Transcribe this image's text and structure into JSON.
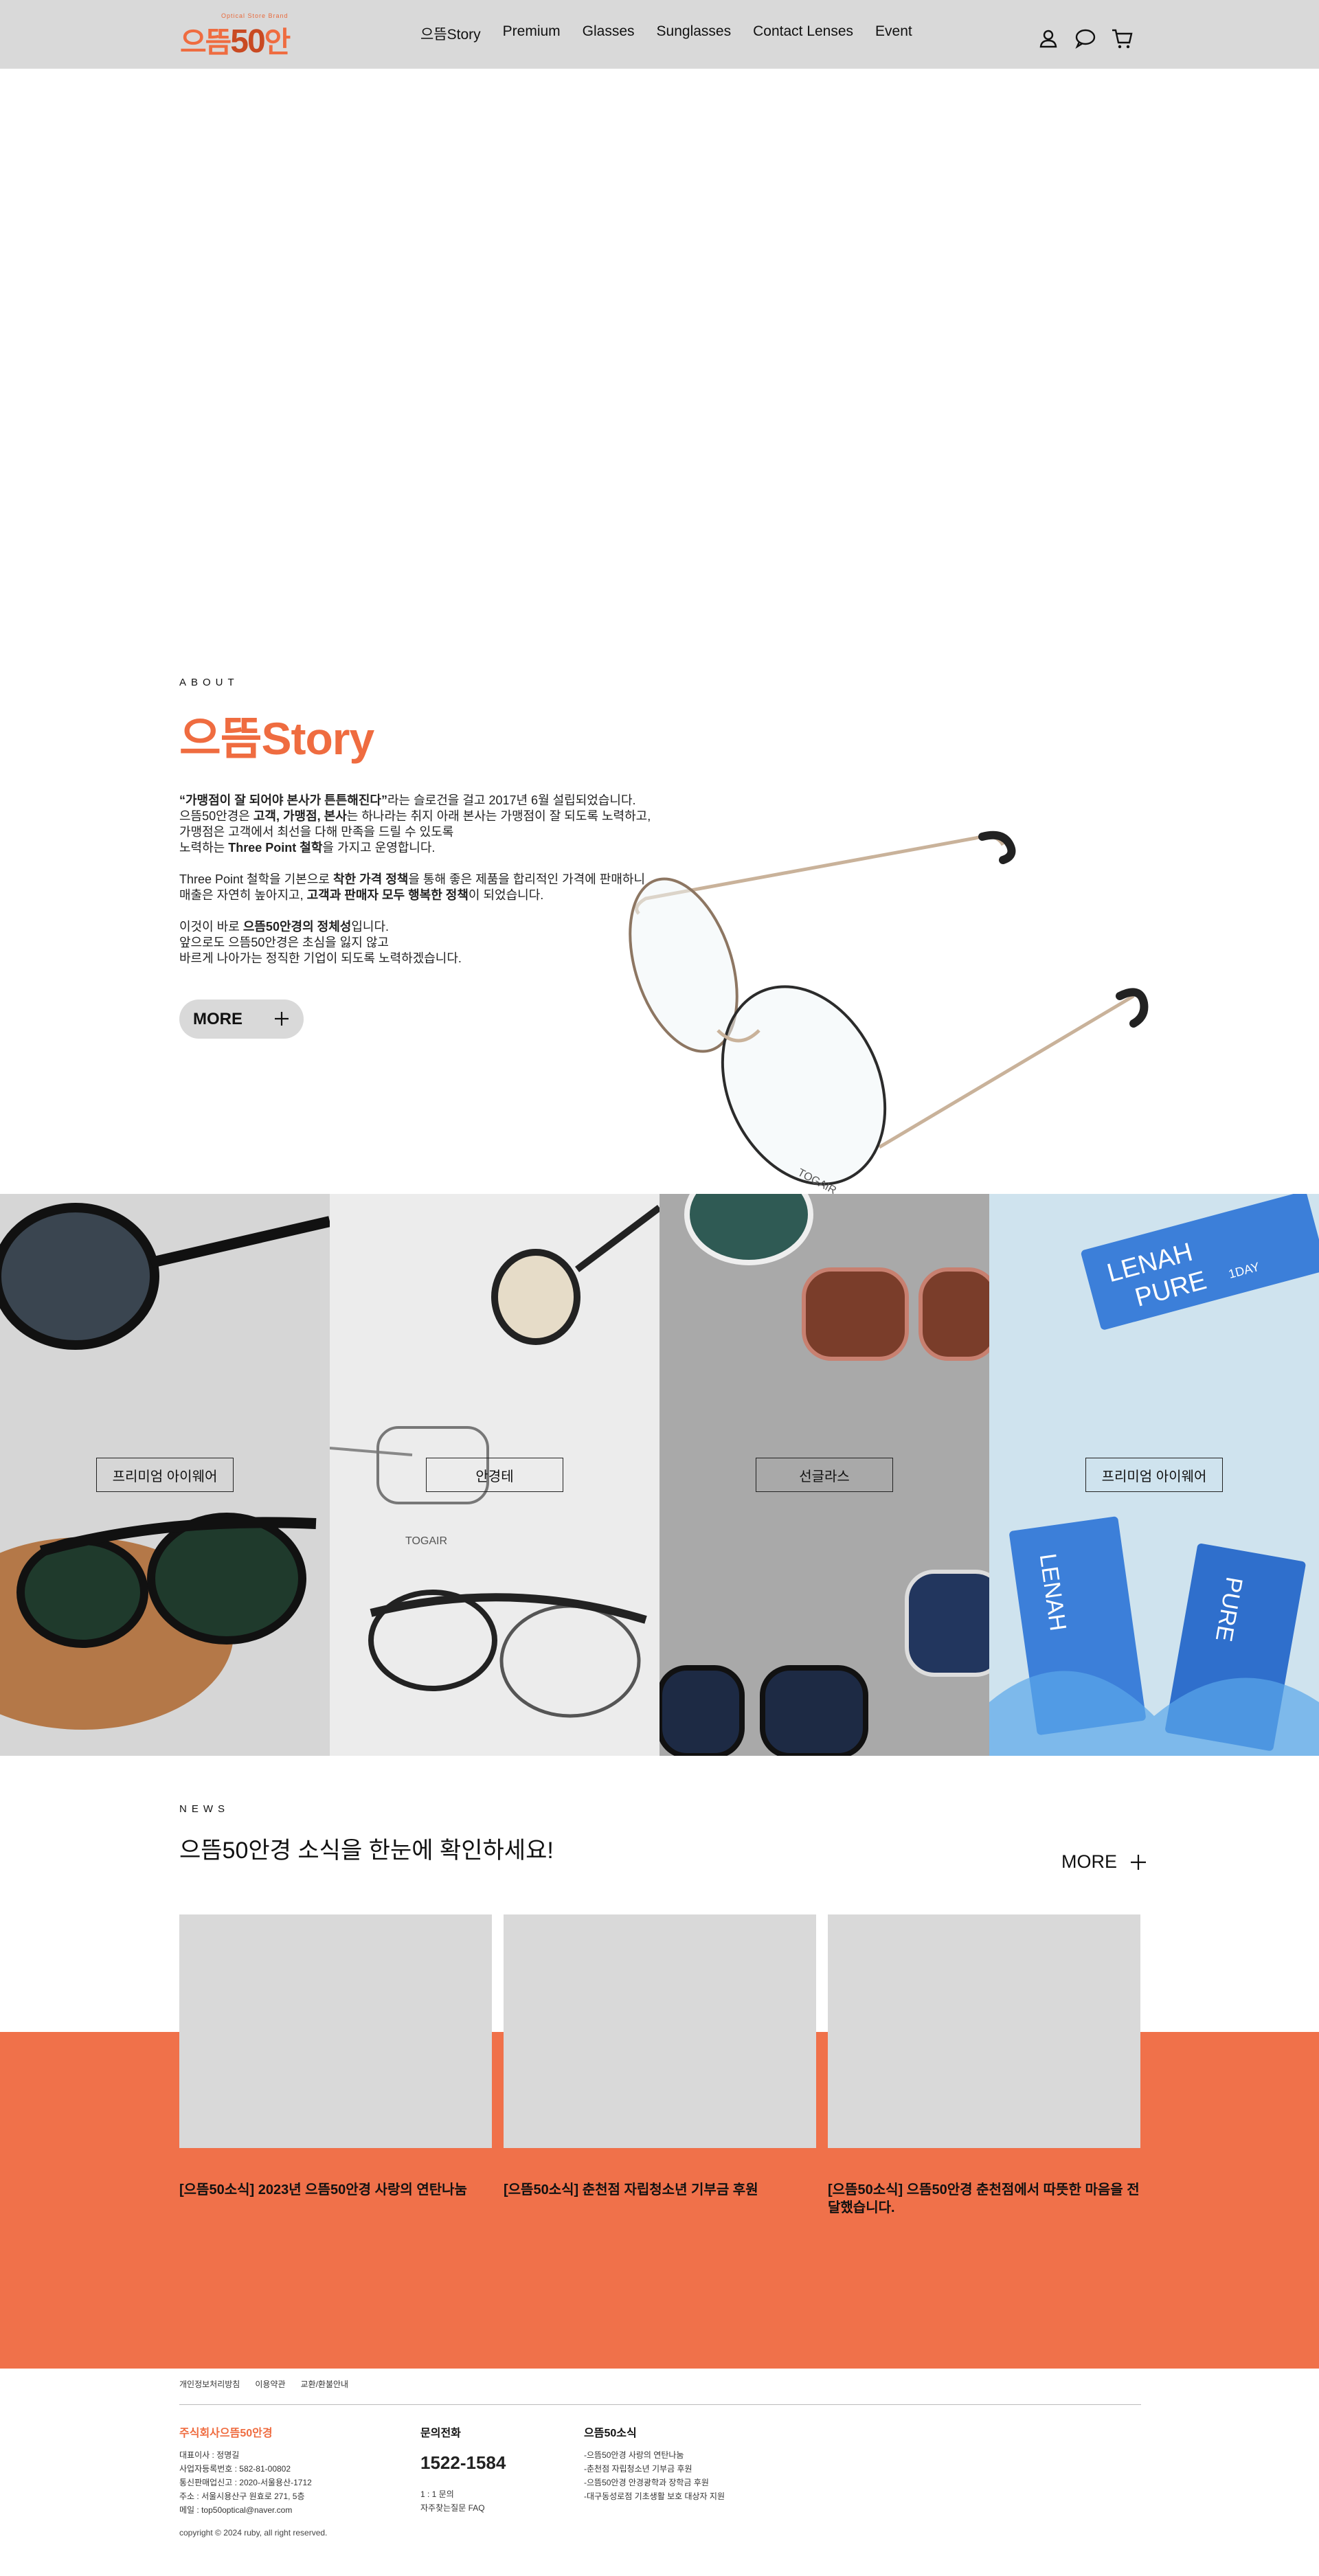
{
  "header": {
    "logo_tagline": "Optical Store Brand",
    "logo_text_a": "으뜸",
    "logo_text_b": "50",
    "logo_text_c": "안경",
    "nav": [
      "으뜸Story",
      "Premium",
      "Glasses",
      "Sunglasses",
      "Contact Lenses",
      "Event"
    ],
    "icons": [
      "user-icon",
      "chat-icon",
      "cart-icon"
    ]
  },
  "about": {
    "eyebrow": "ABOUT",
    "title": "으뜸Story",
    "p1_l1_b": "“가맹점이 잘 되어야 본사가 튼튼해진다”",
    "p1_l1": "라는 슬로건을 걸고 2017년 6월 설립되었습니다.",
    "p1_l2a": "으뜸50안경은 ",
    "p1_l2b": "고객, 가맹점, 본사",
    "p1_l2c": "는 하나라는 취지 아래 본사는 가맹점이 잘 되도록 노력하고,",
    "p1_l3": "가맹점은 고객에서 최선을 다해 만족을 드릴 수 있도록",
    "p1_l4a": "노력하는 ",
    "p1_l4b": "Three Point 철학",
    "p1_l4c": "을 가지고 운영합니다.",
    "p2_l1a": "Three Point 철학을 기본으로 ",
    "p2_l1b": "착한 가격 정책",
    "p2_l1c": "을 통해 좋은 제품을 합리적인 가격에 판매하니",
    "p2_l2a": "매출은 자연히 높아지고, ",
    "p2_l2b": "고객과 판매자 모두 행복한 정책",
    "p2_l2c": "이 되었습니다.",
    "p3_l1a": "이것이 바로 ",
    "p3_l1b": "으뜸50안경의 정체성",
    "p3_l1c": "입니다.",
    "p3_l2": "앞으로도 으뜸50안경은 초심을 잃지 않고",
    "p3_l3": "바르게 나아가는 정직한 기업이 되도록 노력하겠습니다.",
    "more_label": "MORE",
    "frame_engraving": "TOGAIR"
  },
  "tiles": [
    {
      "caption": "프리미엄 아이웨어",
      "bg": "#d6d6d6"
    },
    {
      "caption": "안경테",
      "bg": "#ececec",
      "engraving": "TOGAIR"
    },
    {
      "caption": "선글라스",
      "bg": "#a9a9a9"
    },
    {
      "caption": "프리미엄 아이웨어",
      "bg": "#cfe3ee",
      "brand_a": "LENAH",
      "brand_b": "PURE",
      "badge": "1DAY"
    }
  ],
  "news": {
    "eyebrow": "NEWS",
    "title": "으뜸50안경 소식을 한눈에 확인하세요!",
    "more_label": "MORE",
    "cards": [
      {
        "title": "[으뜸50소식] 2023년 으뜸50안경 사랑의 연탄나눔"
      },
      {
        "title": "[으뜸50소식] 춘천점 자립청소년 기부금 후원"
      },
      {
        "title": "[으뜸50소식] 으뜸50안경 춘천점에서 따뜻한 마음을 전달했습니다."
      }
    ]
  },
  "footer": {
    "links": [
      "개인정보처리방침",
      "이용약관",
      "교환/환불안내"
    ],
    "company": {
      "name": "주식회사으뜸50안경",
      "lines": [
        "대표이사 : 정명길",
        "사업자등록번호 : 582-81-00802",
        "통신판매업신고 : 2020-서울용산-1712",
        "주소 : 서울시용산구 원효로 271, 5층",
        "메일 : top50optical@naver.com"
      ]
    },
    "contact": {
      "title": "문의전화",
      "phone": "1522-1584",
      "lines": [
        "1 : 1 문의",
        "자주찾는질문 FAQ"
      ]
    },
    "news": {
      "title": "으뜸50소식",
      "lines": [
        "-으뜸50안경 사랑의 연탄나눔",
        "-춘천점 자립청소년 기부금 후원",
        "-으뜸50안경 안경광학과 장학금 후원",
        "-대구동성로점 기초생활 보호 대상자 지원"
      ]
    },
    "copyright": "copyright © 2024 ruby, all right reserved."
  },
  "colors": {
    "accent": "#ef6c40",
    "band": "#f0714a",
    "header": "#d9d9d9"
  }
}
